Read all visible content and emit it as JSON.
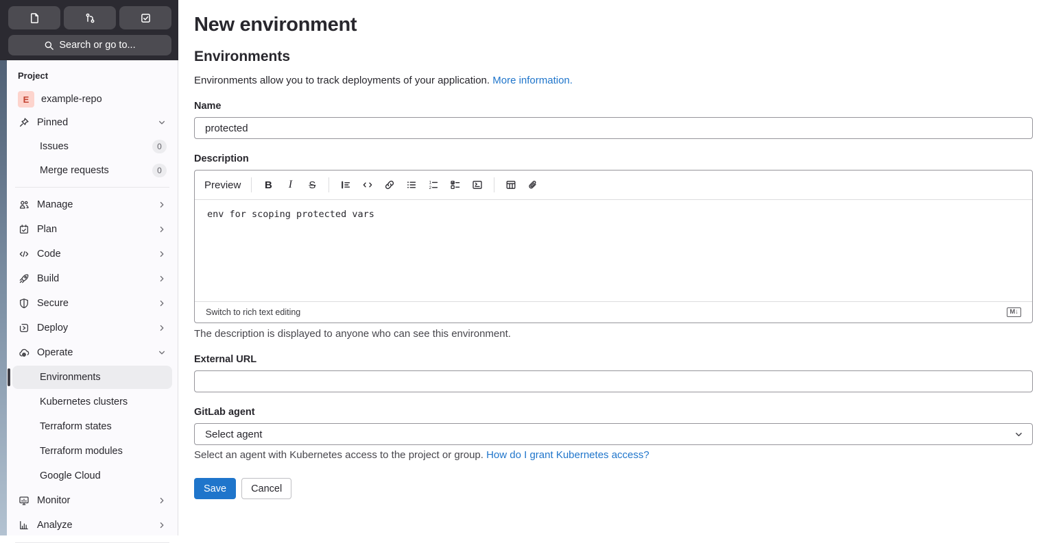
{
  "colors": {
    "accent_blue": "#1f75cb",
    "dark_header_bg": "#2b2a31",
    "dark_button_bg": "#4c4b51",
    "sidebar_bg": "#fbfafd",
    "active_item_bg": "#ececef",
    "avatar_bg": "#fdd4cd",
    "avatar_text": "#c24231"
  },
  "sidebar": {
    "search_placeholder": "Search or go to...",
    "section_label": "Project",
    "project": {
      "avatar_letter": "E",
      "name": "example-repo"
    },
    "pinned_label": "Pinned",
    "pinned_items": [
      {
        "label": "Issues",
        "count": "0"
      },
      {
        "label": "Merge requests",
        "count": "0"
      }
    ],
    "nav_items": [
      {
        "label": "Manage"
      },
      {
        "label": "Plan"
      },
      {
        "label": "Code"
      },
      {
        "label": "Build"
      },
      {
        "label": "Secure"
      },
      {
        "label": "Deploy"
      },
      {
        "label": "Operate"
      }
    ],
    "operate_children": [
      {
        "label": "Environments"
      },
      {
        "label": "Kubernetes clusters"
      },
      {
        "label": "Terraform states"
      },
      {
        "label": "Terraform modules"
      },
      {
        "label": "Google Cloud"
      }
    ],
    "bottom_nav_items": [
      {
        "label": "Monitor"
      },
      {
        "label": "Analyze"
      }
    ]
  },
  "main": {
    "page_title": "New environment",
    "section_title": "Environments",
    "intro_text": "Environments allow you to track deployments of your application. ",
    "intro_link_text": "More information.",
    "name_field": {
      "label": "Name",
      "value": "protected"
    },
    "description_field": {
      "label": "Description",
      "preview_label": "Preview",
      "content": "env for scoping protected vars",
      "switch_link": "Switch to rich text editing",
      "markdown_badge": "M↓",
      "help_text": "The description is displayed to anyone who can see this environment."
    },
    "external_url_field": {
      "label": "External URL",
      "value": ""
    },
    "agent_field": {
      "label": "GitLab agent",
      "selected": "Select agent",
      "help_text": "Select an agent with Kubernetes access to the project or group. ",
      "help_link_text": "How do I grant Kubernetes access?"
    },
    "save_label": "Save",
    "cancel_label": "Cancel"
  }
}
